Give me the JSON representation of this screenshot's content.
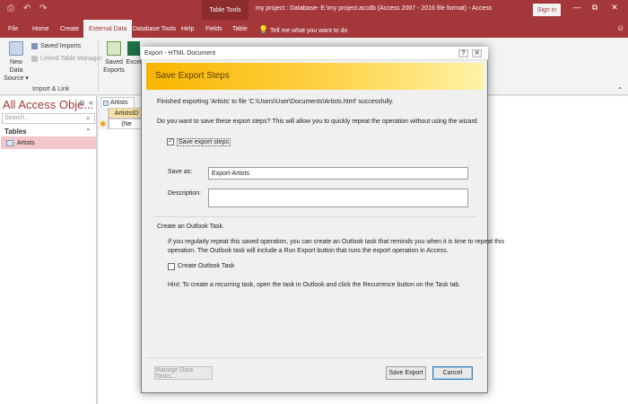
{
  "titlebar": {
    "context_tab": "Table Tools",
    "title": "my project : Database- E:\\my project.accdb (Access 2007 - 2016 file format) - Access",
    "signin": "Sign in",
    "minimize": "—",
    "restore": "⧉",
    "close": "✕",
    "quick_access": [
      "⎙",
      "↶",
      "↷"
    ]
  },
  "ribbon_tabs": [
    "File",
    "Home",
    "Create",
    "External Data",
    "Database Tools",
    "Help",
    "Fields",
    "Table"
  ],
  "active_tab": "External Data",
  "tell_me": "Tell me what you want to do",
  "ribbon": {
    "new_data_source_line1": "New Data",
    "new_data_source_line2": "Source",
    "saved_imports": "Saved Imports",
    "linked_table_manager": "Linked Table Manager",
    "group_import": "Import & Link",
    "saved_exports_line1": "Saved",
    "saved_exports_line2": "Exports",
    "excel": "Excel"
  },
  "nav": {
    "title": "All Access Obje...",
    "search_placeholder": "Search...",
    "section": "Tables",
    "items": [
      {
        "label": "Artists"
      }
    ]
  },
  "datasheet": {
    "tab": "Artists",
    "column": "ArtistsID",
    "new_row": "(Ne"
  },
  "dialog": {
    "title": "Export - HTML Document",
    "help": "?",
    "close": "✕",
    "banner": "Save Export Steps",
    "finished_msg": "Finished exporting 'Artists' to file 'C:\\Users\\User\\Documents\\Artists.html' successfully.",
    "question": "Do you want to save these export steps? This will allow you to quickly repeat the operation without using the wizard.",
    "save_steps_label": "Save export steps",
    "save_steps_checked": true,
    "save_as_label": "Save as:",
    "save_as_value": "Export-Artists",
    "description_label": "Description:",
    "description_value": "",
    "outlook_header": "Create an Outlook Task.",
    "outlook_para_1": "If you regularly repeat this saved operation, you can create an Outlook task that reminds you when it is time to repeat this",
    "outlook_para_2": "operation. The Outlook task will include a Run Export button that runs the export operation in Access.",
    "create_task_label": "Create Outlook Task",
    "create_task_checked": false,
    "hint": "Hint: To create a recurring task, open the task in Outlook and click the Recurrence button on the Task tab.",
    "manage_btn": "Manage Data Tasks...",
    "save_btn": "Save Export",
    "cancel_btn": "Cancel"
  },
  "colors": {
    "brand": "#a4373a",
    "banner_start": "#f7b500",
    "banner_end": "#fff2a8",
    "selected_item": "#f3c7c9",
    "column_header": "#f9e1a4"
  }
}
